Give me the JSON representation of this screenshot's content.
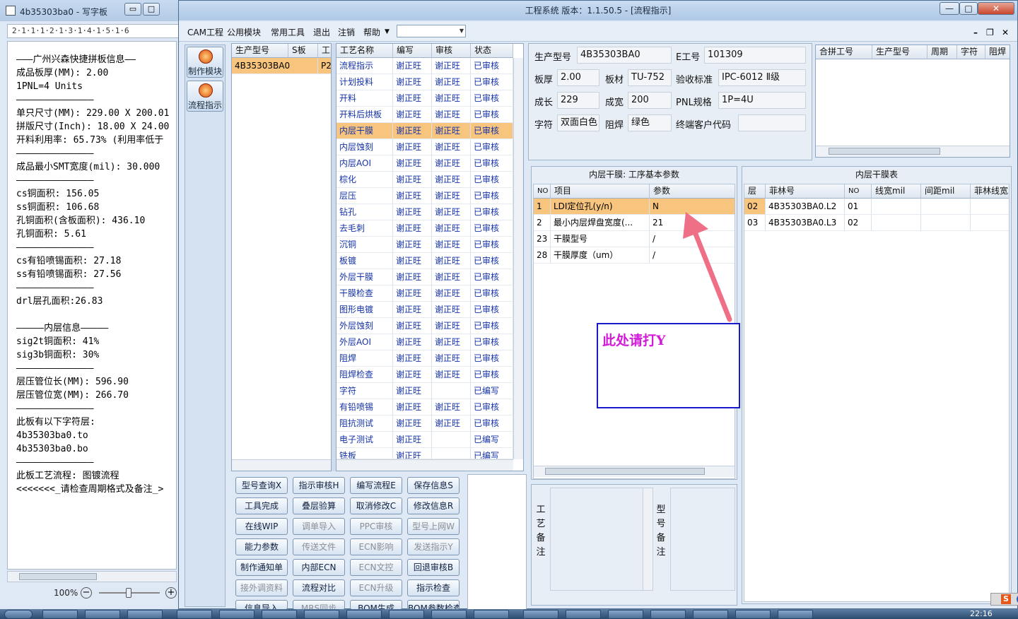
{
  "wordpad": {
    "title": "4b35303ba0 - 写字板",
    "min": "▭",
    "max": "□",
    "ruler": "2·1·1·1·2·1·3·1·4·1·5·1·6",
    "lines": [
      "———广州兴森快捷拼板信息——",
      "成品板厚(MM): 2.00",
      "1PNL=4 Units",
      "——————————————",
      "单只尺寸(MM): 229.00 X 200.01",
      "拼版尺寸(Inch): 18.00 X 24.00",
      "开料利用率: 65.73% (利用率低于",
      "——————————————",
      "成品最小SMT宽度(mil): 30.000",
      "——————————————",
      "cs铜面积: 156.05",
      "ss铜面积: 106.68",
      "孔铜面积(含板面积): 436.10",
      "孔铜面积: 5.61",
      "——————————————",
      "cs有铅喷锡面积: 27.18",
      "ss有铅喷锡面积: 27.56",
      "——————————————",
      "drl层孔面积:26.83",
      "",
      "—————内层信息—————",
      "sig2t铜面积: 41%",
      "sig3b铜面积: 30%",
      "——————————————",
      "层压管位长(MM): 596.90",
      "层压管位宽(MM): 266.70",
      "——————————————",
      "此板有以下字符层:",
      "4b35303ba0.to",
      "4b35303ba0.bo",
      "——————————————",
      "此板工艺流程: 图镀流程",
      "<<<<<<<_请检查周期格式及备注_>"
    ],
    "zoom": "100%",
    "zoom_minus": "−",
    "zoom_plus": "+"
  },
  "main": {
    "title": "工程系统   版本：1.1.50.5 - [流程指示]",
    "win_min": "—",
    "win_max": "□",
    "win_close": "✕",
    "menus": [
      "CAM工程",
      "公用模块",
      "常用工具",
      "退出",
      "注销",
      "帮助"
    ],
    "mdi_min": "–",
    "mdi_restore": "❐",
    "mdi_close": "✕",
    "modules": [
      "制作模块",
      "流程指示"
    ]
  },
  "type_grid": {
    "headers": [
      "生产型号",
      "S板",
      "工"
    ],
    "rows": [
      [
        "4B35303BA0",
        "",
        "P2"
      ]
    ]
  },
  "process_grid": {
    "headers": [
      "工艺名称",
      "编写",
      "审核",
      "状态"
    ],
    "rows": [
      [
        "流程指示",
        "谢正旺",
        "谢正旺",
        "已审核"
      ],
      [
        "计划投料",
        "谢正旺",
        "谢正旺",
        "已审核"
      ],
      [
        "开料",
        "谢正旺",
        "谢正旺",
        "已审核"
      ],
      [
        "开料后烘板",
        "谢正旺",
        "谢正旺",
        "已审核"
      ],
      [
        "内层干膜",
        "谢正旺",
        "谢正旺",
        "已审核"
      ],
      [
        "内层蚀刻",
        "谢正旺",
        "谢正旺",
        "已审核"
      ],
      [
        "内层AOI",
        "谢正旺",
        "谢正旺",
        "已审核"
      ],
      [
        "棕化",
        "谢正旺",
        "谢正旺",
        "已审核"
      ],
      [
        "层压",
        "谢正旺",
        "谢正旺",
        "已审核"
      ],
      [
        "钻孔",
        "谢正旺",
        "谢正旺",
        "已审核"
      ],
      [
        "去毛刺",
        "谢正旺",
        "谢正旺",
        "已审核"
      ],
      [
        "沉铜",
        "谢正旺",
        "谢正旺",
        "已审核"
      ],
      [
        "板镀",
        "谢正旺",
        "谢正旺",
        "已审核"
      ],
      [
        "外层干膜",
        "谢正旺",
        "谢正旺",
        "已审核"
      ],
      [
        "干膜检查",
        "谢正旺",
        "谢正旺",
        "已审核"
      ],
      [
        "图形电镀",
        "谢正旺",
        "谢正旺",
        "已审核"
      ],
      [
        "外层蚀刻",
        "谢正旺",
        "谢正旺",
        "已审核"
      ],
      [
        "外层AOI",
        "谢正旺",
        "谢正旺",
        "已审核"
      ],
      [
        "阻焊",
        "谢正旺",
        "谢正旺",
        "已审核"
      ],
      [
        "阻焊检查",
        "谢正旺",
        "谢正旺",
        "已审核"
      ],
      [
        "字符",
        "谢正旺",
        "",
        "已编写"
      ],
      [
        "有铅喷锡",
        "谢正旺",
        "谢正旺",
        "已审核"
      ],
      [
        "阻抗测试",
        "谢正旺",
        "谢正旺",
        "已审核"
      ],
      [
        "电子测试",
        "谢正旺",
        "",
        "已编写"
      ],
      [
        "铣板",
        "谢正旺",
        "",
        "已编写"
      ]
    ]
  },
  "info": {
    "model_label": "生产型号",
    "model": "4B35303BA0",
    "eno_label": "E工号",
    "eno": "101309",
    "thick_label": "板厚",
    "thick": "2.00",
    "mat_label": "板材",
    "mat": "TU-752",
    "std_label": "验收标准",
    "std": "IPC-6012 Ⅱ级",
    "len_label": "成长",
    "len": "229",
    "wid_label": "成宽",
    "wid": "200",
    "pnl_label": "PNL规格",
    "pnl": "1P=4U",
    "char_label": "字符",
    "char": "双面白色",
    "mask_label": "阻焊",
    "mask": "绿色",
    "cust_label": "终端客户代码",
    "cust": ""
  },
  "merge_grid": {
    "headers": [
      "合拼工号",
      "生产型号",
      "周期",
      "字符",
      "阻焊"
    ]
  },
  "param_panel": {
    "title": "内层干膜: 工序基本参数",
    "headers": [
      "NO",
      "项目",
      "参数"
    ],
    "rows": [
      [
        "1",
        "LDI定位孔(y/n)",
        "N"
      ],
      [
        "2",
        "最小内层焊盘宽度(...",
        "21"
      ],
      [
        "23",
        "干膜型号",
        "/"
      ],
      [
        "28",
        "干膜厚度（um）",
        "/"
      ]
    ]
  },
  "film_panel": {
    "title": "内层干膜表",
    "headers": [
      "层",
      "菲林号",
      "NO",
      "线宽mil",
      "间距mil",
      "菲林线宽"
    ],
    "rows": [
      [
        "02",
        "4B35303BA0.L2",
        "01",
        "",
        "",
        ""
      ],
      [
        "03",
        "4B35303BA0.L3",
        "02",
        "",
        "",
        ""
      ]
    ]
  },
  "buttons": [
    {
      "label": "型号查询X",
      "enabled": true
    },
    {
      "label": "指示审核H",
      "enabled": true
    },
    {
      "label": "编写流程E",
      "enabled": true
    },
    {
      "label": "保存信息S",
      "enabled": true
    },
    {
      "label": "工具完成",
      "enabled": true
    },
    {
      "label": "叠层验算",
      "enabled": true
    },
    {
      "label": "取消修改C",
      "enabled": true
    },
    {
      "label": "修改信息R",
      "enabled": true
    },
    {
      "label": "在线WIP",
      "enabled": true
    },
    {
      "label": "调单导入",
      "enabled": false
    },
    {
      "label": "PPC审核",
      "enabled": false
    },
    {
      "label": "型号上网W",
      "enabled": false
    },
    {
      "label": "能力参数",
      "enabled": true
    },
    {
      "label": "传送文件",
      "enabled": false
    },
    {
      "label": "ECN影响",
      "enabled": false
    },
    {
      "label": "发送指示Y",
      "enabled": false
    },
    {
      "label": "制作通知单",
      "enabled": true
    },
    {
      "label": "内部ECN",
      "enabled": true
    },
    {
      "label": "ECN文控",
      "enabled": false
    },
    {
      "label": "回退审核B",
      "enabled": true
    },
    {
      "label": "接外调资料",
      "enabled": false
    },
    {
      "label": "流程对比",
      "enabled": true
    },
    {
      "label": "ECN升级",
      "enabled": false
    },
    {
      "label": "指示检查",
      "enabled": true
    },
    {
      "label": "信息导入",
      "enabled": true
    },
    {
      "label": "MRS同步",
      "enabled": false
    },
    {
      "label": "BOM生成",
      "enabled": true
    },
    {
      "label": "BOM参数检查",
      "enabled": true
    }
  ],
  "remarks": {
    "process_label": "工艺备注",
    "model_label": "型号备注"
  },
  "callout": {
    "text": "此处请打Y",
    "arrow_color": "#ee6f86"
  },
  "ime": {
    "s": "S"
  },
  "taskbar": {
    "clock": "22:16"
  }
}
